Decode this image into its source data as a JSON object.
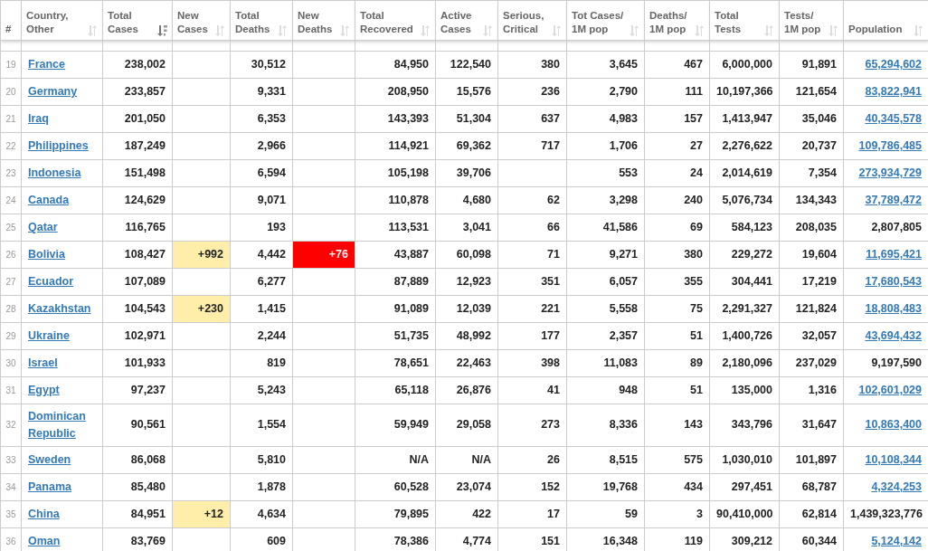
{
  "table": {
    "columns": [
      {
        "label": "#"
      },
      {
        "label": "Country,\nOther",
        "sorted": false
      },
      {
        "label": "Total\nCases",
        "sorted": true
      },
      {
        "label": "New\nCases",
        "sorted": false
      },
      {
        "label": "Total\nDeaths",
        "sorted": false
      },
      {
        "label": "New\nDeaths",
        "sorted": false
      },
      {
        "label": "Total\nRecovered",
        "sorted": false
      },
      {
        "label": "Active\nCases",
        "sorted": false
      },
      {
        "label": "Serious,\nCritical",
        "sorted": false
      },
      {
        "label": "Tot Cases/\n1M pop",
        "sorted": false
      },
      {
        "label": "Deaths/\n1M pop",
        "sorted": false
      },
      {
        "label": "Total\nTests",
        "sorted": false
      },
      {
        "label": "Tests/\n1M pop",
        "sorted": false
      },
      {
        "label": "Population",
        "sorted": false
      }
    ],
    "rows": [
      {
        "rank": "19",
        "country": "France",
        "total_cases": "238,002",
        "total_deaths": "30,512",
        "total_recovered": "84,950",
        "active_cases": "122,540",
        "serious": "380",
        "cases_per_1m": "3,645",
        "deaths_per_1m": "467",
        "total_tests": "6,000,000",
        "tests_per_1m": "91,891",
        "population": "65,294,602",
        "population_link": true
      },
      {
        "rank": "20",
        "country": "Germany",
        "total_cases": "233,857",
        "total_deaths": "9,331",
        "total_recovered": "208,950",
        "active_cases": "15,576",
        "serious": "236",
        "cases_per_1m": "2,790",
        "deaths_per_1m": "111",
        "total_tests": "10,197,366",
        "tests_per_1m": "121,654",
        "population": "83,822,941",
        "population_link": true
      },
      {
        "rank": "21",
        "country": "Iraq",
        "total_cases": "201,050",
        "total_deaths": "6,353",
        "total_recovered": "143,393",
        "active_cases": "51,304",
        "serious": "637",
        "cases_per_1m": "4,983",
        "deaths_per_1m": "157",
        "total_tests": "1,413,947",
        "tests_per_1m": "35,046",
        "population": "40,345,578",
        "population_link": true
      },
      {
        "rank": "22",
        "country": "Philippines",
        "total_cases": "187,249",
        "total_deaths": "2,966",
        "total_recovered": "114,921",
        "active_cases": "69,362",
        "serious": "717",
        "cases_per_1m": "1,706",
        "deaths_per_1m": "27",
        "total_tests": "2,276,622",
        "tests_per_1m": "20,737",
        "population": "109,786,485",
        "population_link": true
      },
      {
        "rank": "23",
        "country": "Indonesia",
        "total_cases": "151,498",
        "total_deaths": "6,594",
        "total_recovered": "105,198",
        "active_cases": "39,706",
        "cases_per_1m": "553",
        "deaths_per_1m": "24",
        "total_tests": "2,014,619",
        "tests_per_1m": "7,354",
        "population": "273,934,729",
        "population_link": true
      },
      {
        "rank": "24",
        "country": "Canada",
        "total_cases": "124,629",
        "total_deaths": "9,071",
        "total_recovered": "110,878",
        "active_cases": "4,680",
        "serious": "62",
        "cases_per_1m": "3,298",
        "deaths_per_1m": "240",
        "total_tests": "5,076,734",
        "tests_per_1m": "134,343",
        "population": "37,789,472",
        "population_link": true
      },
      {
        "rank": "25",
        "country": "Qatar",
        "total_cases": "116,765",
        "total_deaths": "193",
        "total_recovered": "113,531",
        "active_cases": "3,041",
        "serious": "66",
        "cases_per_1m": "41,586",
        "deaths_per_1m": "69",
        "total_tests": "584,123",
        "tests_per_1m": "208,035",
        "population": "2,807,805",
        "population_link": false
      },
      {
        "rank": "26",
        "country": "Bolivia",
        "total_cases": "108,427",
        "new_cases": "+992",
        "total_deaths": "4,442",
        "new_deaths": "+76",
        "total_recovered": "43,887",
        "active_cases": "60,098",
        "serious": "71",
        "cases_per_1m": "9,271",
        "deaths_per_1m": "380",
        "total_tests": "229,272",
        "tests_per_1m": "19,604",
        "population": "11,695,421",
        "population_link": true
      },
      {
        "rank": "27",
        "country": "Ecuador",
        "total_cases": "107,089",
        "total_deaths": "6,277",
        "total_recovered": "87,889",
        "active_cases": "12,923",
        "serious": "351",
        "cases_per_1m": "6,057",
        "deaths_per_1m": "355",
        "total_tests": "304,441",
        "tests_per_1m": "17,219",
        "population": "17,680,543",
        "population_link": true
      },
      {
        "rank": "28",
        "country": "Kazakhstan",
        "total_cases": "104,543",
        "new_cases": "+230",
        "total_deaths": "1,415",
        "total_recovered": "91,089",
        "active_cases": "12,039",
        "serious": "221",
        "cases_per_1m": "5,558",
        "deaths_per_1m": "75",
        "total_tests": "2,291,327",
        "tests_per_1m": "121,824",
        "population": "18,808,483",
        "population_link": true
      },
      {
        "rank": "29",
        "country": "Ukraine",
        "total_cases": "102,971",
        "total_deaths": "2,244",
        "total_recovered": "51,735",
        "active_cases": "48,992",
        "serious": "177",
        "cases_per_1m": "2,357",
        "deaths_per_1m": "51",
        "total_tests": "1,400,726",
        "tests_per_1m": "32,057",
        "population": "43,694,432",
        "population_link": true
      },
      {
        "rank": "30",
        "country": "Israel",
        "total_cases": "101,933",
        "total_deaths": "819",
        "total_recovered": "78,651",
        "active_cases": "22,463",
        "serious": "398",
        "cases_per_1m": "11,083",
        "deaths_per_1m": "89",
        "total_tests": "2,180,096",
        "tests_per_1m": "237,029",
        "population": "9,197,590",
        "population_link": false
      },
      {
        "rank": "31",
        "country": "Egypt",
        "total_cases": "97,237",
        "total_deaths": "5,243",
        "total_recovered": "65,118",
        "active_cases": "26,876",
        "serious": "41",
        "cases_per_1m": "948",
        "deaths_per_1m": "51",
        "total_tests": "135,000",
        "tests_per_1m": "1,316",
        "population": "102,601,029",
        "population_link": true
      },
      {
        "rank": "32",
        "country": "Dominican Republic",
        "total_cases": "90,561",
        "total_deaths": "1,554",
        "total_recovered": "59,949",
        "active_cases": "29,058",
        "serious": "273",
        "cases_per_1m": "8,336",
        "deaths_per_1m": "143",
        "total_tests": "343,796",
        "tests_per_1m": "31,647",
        "population": "10,863,400",
        "population_link": true
      },
      {
        "rank": "33",
        "country": "Sweden",
        "total_cases": "86,068",
        "total_deaths": "5,810",
        "total_recovered": "N/A",
        "active_cases": "N/A",
        "serious": "26",
        "cases_per_1m": "8,515",
        "deaths_per_1m": "575",
        "total_tests": "1,030,010",
        "tests_per_1m": "101,897",
        "population": "10,108,344",
        "population_link": true
      },
      {
        "rank": "34",
        "country": "Panama",
        "total_cases": "85,480",
        "total_deaths": "1,878",
        "total_recovered": "60,528",
        "active_cases": "23,074",
        "serious": "152",
        "cases_per_1m": "19,768",
        "deaths_per_1m": "434",
        "total_tests": "297,451",
        "tests_per_1m": "68,787",
        "population": "4,324,253",
        "population_link": true
      },
      {
        "rank": "35",
        "country": "China",
        "total_cases": "84,951",
        "new_cases": "+12",
        "total_deaths": "4,634",
        "total_recovered": "79,895",
        "active_cases": "422",
        "serious": "17",
        "cases_per_1m": "59",
        "deaths_per_1m": "3",
        "total_tests": "90,410,000",
        "tests_per_1m": "62,814",
        "population": "1,439,323,776",
        "population_link": false
      },
      {
        "rank": "36",
        "country": "Oman",
        "total_cases": "83,769",
        "total_deaths": "609",
        "total_recovered": "78,386",
        "active_cases": "4,774",
        "serious": "151",
        "cases_per_1m": "16,348",
        "deaths_per_1m": "119",
        "total_tests": "309,212",
        "tests_per_1m": "60,344",
        "population": "5,124,142",
        "population_link": true
      }
    ]
  }
}
